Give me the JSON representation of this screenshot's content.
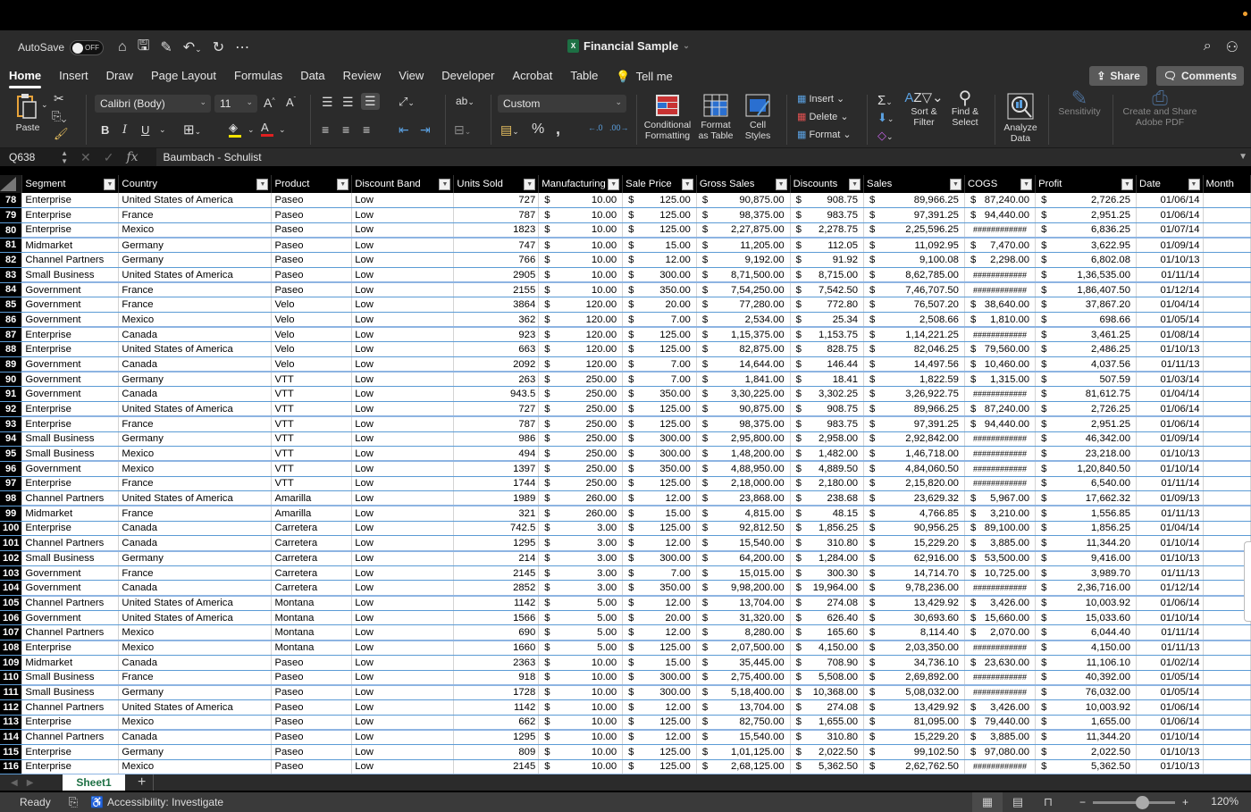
{
  "titlebar": {
    "autosave_label": "AutoSave",
    "autosave_state": "OFF",
    "doc_title": "Financial Sample",
    "app_badge": "X"
  },
  "tabs": [
    "Home",
    "Insert",
    "Draw",
    "Page Layout",
    "Formulas",
    "Data",
    "Review",
    "View",
    "Developer",
    "Acrobat",
    "Table"
  ],
  "active_tab": "Home",
  "tell_me": "Tell me",
  "share_label": "Share",
  "comments_label": "Comments",
  "ribbon": {
    "paste": "Paste",
    "font_name": "Calibri (Body)",
    "font_size": "11",
    "number_format": "Custom",
    "conditional_formatting": [
      "Conditional",
      "Formatting"
    ],
    "format_as_table": [
      "Format",
      "as Table"
    ],
    "cell_styles": [
      "Cell",
      "Styles"
    ],
    "insert": "Insert",
    "delete": "Delete",
    "format": "Format",
    "sort_filter": [
      "Sort &",
      "Filter"
    ],
    "find_select": [
      "Find &",
      "Select"
    ],
    "analyze_data": [
      "Analyze",
      "Data"
    ],
    "sensitivity": "Sensitivity",
    "adobe_pdf": [
      "Create and Share",
      "Adobe PDF"
    ],
    "colors": {
      "highlight": "#f5e400",
      "font_color": "#e02020"
    }
  },
  "formula_bar": {
    "name_box": "Q638",
    "formula": "Baumbach - Schulist"
  },
  "columns": [
    "Segment",
    "Country",
    "Product",
    "Discount Band",
    "Units Sold",
    "Manufacturing",
    "Sale Price",
    "Gross Sales",
    "Discounts",
    "Sales",
    "COGS",
    "Profit",
    "Date",
    "Month"
  ],
  "rows": [
    {
      "n": "78",
      "seg": "Enterprise",
      "country": "United States of America",
      "product": "Paseo",
      "band": "Low",
      "units": "727",
      "mfg": "10.00",
      "price": "125.00",
      "gross": "90,875.00",
      "disc": "908.75",
      "sales": "89,966.25",
      "cogs": "87,240.00",
      "profit": "2,726.25",
      "date": "01/06/14"
    },
    {
      "n": "79",
      "seg": "Enterprise",
      "country": "France",
      "product": "Paseo",
      "band": "Low",
      "units": "787",
      "mfg": "10.00",
      "price": "125.00",
      "gross": "98,375.00",
      "disc": "983.75",
      "sales": "97,391.25",
      "cogs": "94,440.00",
      "profit": "2,951.25",
      "date": "01/06/14"
    },
    {
      "n": "80",
      "seg": "Enterprise",
      "country": "Mexico",
      "product": "Paseo",
      "band": "Low",
      "units": "1823",
      "mfg": "10.00",
      "price": "125.00",
      "gross": "2,27,875.00",
      "disc": "2,278.75",
      "sales": "2,25,596.25",
      "cogs": "############",
      "profit": "6,836.25",
      "date": "01/07/14"
    },
    {
      "n": "81",
      "seg": "Midmarket",
      "country": "Germany",
      "product": "Paseo",
      "band": "Low",
      "units": "747",
      "mfg": "10.00",
      "price": "15.00",
      "gross": "11,205.00",
      "disc": "112.05",
      "sales": "11,092.95",
      "cogs": "7,470.00",
      "profit": "3,622.95",
      "date": "01/09/14"
    },
    {
      "n": "82",
      "seg": "Channel Partners",
      "country": "Germany",
      "product": "Paseo",
      "band": "Low",
      "units": "766",
      "mfg": "10.00",
      "price": "12.00",
      "gross": "9,192.00",
      "disc": "91.92",
      "sales": "9,100.08",
      "cogs": "2,298.00",
      "profit": "6,802.08",
      "date": "01/10/13"
    },
    {
      "n": "83",
      "seg": "Small Business",
      "country": "United States of America",
      "product": "Paseo",
      "band": "Low",
      "units": "2905",
      "mfg": "10.00",
      "price": "300.00",
      "gross": "8,71,500.00",
      "disc": "8,715.00",
      "sales": "8,62,785.00",
      "cogs": "############",
      "profit": "1,36,535.00",
      "date": "01/11/14"
    },
    {
      "n": "84",
      "seg": "Government",
      "country": "France",
      "product": "Paseo",
      "band": "Low",
      "units": "2155",
      "mfg": "10.00",
      "price": "350.00",
      "gross": "7,54,250.00",
      "disc": "7,542.50",
      "sales": "7,46,707.50",
      "cogs": "############",
      "profit": "1,86,407.50",
      "date": "01/12/14"
    },
    {
      "n": "85",
      "seg": "Government",
      "country": "France",
      "product": "Velo",
      "band": "Low",
      "units": "3864",
      "mfg": "120.00",
      "price": "20.00",
      "gross": "77,280.00",
      "disc": "772.80",
      "sales": "76,507.20",
      "cogs": "38,640.00",
      "profit": "37,867.20",
      "date": "01/04/14"
    },
    {
      "n": "86",
      "seg": "Government",
      "country": "Mexico",
      "product": "Velo",
      "band": "Low",
      "units": "362",
      "mfg": "120.00",
      "price": "7.00",
      "gross": "2,534.00",
      "disc": "25.34",
      "sales": "2,508.66",
      "cogs": "1,810.00",
      "profit": "698.66",
      "date": "01/05/14"
    },
    {
      "n": "87",
      "seg": "Enterprise",
      "country": "Canada",
      "product": "Velo",
      "band": "Low",
      "units": "923",
      "mfg": "120.00",
      "price": "125.00",
      "gross": "1,15,375.00",
      "disc": "1,153.75",
      "sales": "1,14,221.25",
      "cogs": "############",
      "profit": "3,461.25",
      "date": "01/08/14"
    },
    {
      "n": "88",
      "seg": "Enterprise",
      "country": "United States of America",
      "product": "Velo",
      "band": "Low",
      "units": "663",
      "mfg": "120.00",
      "price": "125.00",
      "gross": "82,875.00",
      "disc": "828.75",
      "sales": "82,046.25",
      "cogs": "79,560.00",
      "profit": "2,486.25",
      "date": "01/10/13"
    },
    {
      "n": "89",
      "seg": "Government",
      "country": "Canada",
      "product": "Velo",
      "band": "Low",
      "units": "2092",
      "mfg": "120.00",
      "price": "7.00",
      "gross": "14,644.00",
      "disc": "146.44",
      "sales": "14,497.56",
      "cogs": "10,460.00",
      "profit": "4,037.56",
      "date": "01/11/13"
    },
    {
      "n": "90",
      "seg": "Government",
      "country": "Germany",
      "product": "VTT",
      "band": "Low",
      "units": "263",
      "mfg": "250.00",
      "price": "7.00",
      "gross": "1,841.00",
      "disc": "18.41",
      "sales": "1,822.59",
      "cogs": "1,315.00",
      "profit": "507.59",
      "date": "01/03/14"
    },
    {
      "n": "91",
      "seg": "Government",
      "country": "Canada",
      "product": "VTT",
      "band": "Low",
      "units": "943.5",
      "mfg": "250.00",
      "price": "350.00",
      "gross": "3,30,225.00",
      "disc": "3,302.25",
      "sales": "3,26,922.75",
      "cogs": "############",
      "profit": "81,612.75",
      "date": "01/04/14"
    },
    {
      "n": "92",
      "seg": "Enterprise",
      "country": "United States of America",
      "product": "VTT",
      "band": "Low",
      "units": "727",
      "mfg": "250.00",
      "price": "125.00",
      "gross": "90,875.00",
      "disc": "908.75",
      "sales": "89,966.25",
      "cogs": "87,240.00",
      "profit": "2,726.25",
      "date": "01/06/14"
    },
    {
      "n": "93",
      "seg": "Enterprise",
      "country": "France",
      "product": "VTT",
      "band": "Low",
      "units": "787",
      "mfg": "250.00",
      "price": "125.00",
      "gross": "98,375.00",
      "disc": "983.75",
      "sales": "97,391.25",
      "cogs": "94,440.00",
      "profit": "2,951.25",
      "date": "01/06/14"
    },
    {
      "n": "94",
      "seg": "Small Business",
      "country": "Germany",
      "product": "VTT",
      "band": "Low",
      "units": "986",
      "mfg": "250.00",
      "price": "300.00",
      "gross": "2,95,800.00",
      "disc": "2,958.00",
      "sales": "2,92,842.00",
      "cogs": "############",
      "profit": "46,342.00",
      "date": "01/09/14"
    },
    {
      "n": "95",
      "seg": "Small Business",
      "country": "Mexico",
      "product": "VTT",
      "band": "Low",
      "units": "494",
      "mfg": "250.00",
      "price": "300.00",
      "gross": "1,48,200.00",
      "disc": "1,482.00",
      "sales": "1,46,718.00",
      "cogs": "############",
      "profit": "23,218.00",
      "date": "01/10/13"
    },
    {
      "n": "96",
      "seg": "Government",
      "country": "Mexico",
      "product": "VTT",
      "band": "Low",
      "units": "1397",
      "mfg": "250.00",
      "price": "350.00",
      "gross": "4,88,950.00",
      "disc": "4,889.50",
      "sales": "4,84,060.50",
      "cogs": "############",
      "profit": "1,20,840.50",
      "date": "01/10/14"
    },
    {
      "n": "97",
      "seg": "Enterprise",
      "country": "France",
      "product": "VTT",
      "band": "Low",
      "units": "1744",
      "mfg": "250.00",
      "price": "125.00",
      "gross": "2,18,000.00",
      "disc": "2,180.00",
      "sales": "2,15,820.00",
      "cogs": "############",
      "profit": "6,540.00",
      "date": "01/11/14"
    },
    {
      "n": "98",
      "seg": "Channel Partners",
      "country": "United States of America",
      "product": "Amarilla",
      "band": "Low",
      "units": "1989",
      "mfg": "260.00",
      "price": "12.00",
      "gross": "23,868.00",
      "disc": "238.68",
      "sales": "23,629.32",
      "cogs": "5,967.00",
      "profit": "17,662.32",
      "date": "01/09/13"
    },
    {
      "n": "99",
      "seg": "Midmarket",
      "country": "France",
      "product": "Amarilla",
      "band": "Low",
      "units": "321",
      "mfg": "260.00",
      "price": "15.00",
      "gross": "4,815.00",
      "disc": "48.15",
      "sales": "4,766.85",
      "cogs": "3,210.00",
      "profit": "1,556.85",
      "date": "01/11/13"
    },
    {
      "n": "100",
      "seg": "Enterprise",
      "country": "Canada",
      "product": "Carretera",
      "band": "Low",
      "units": "742.5",
      "mfg": "3.00",
      "price": "125.00",
      "gross": "92,812.50",
      "disc": "1,856.25",
      "sales": "90,956.25",
      "cogs": "89,100.00",
      "profit": "1,856.25",
      "date": "01/04/14"
    },
    {
      "n": "101",
      "seg": "Channel Partners",
      "country": "Canada",
      "product": "Carretera",
      "band": "Low",
      "units": "1295",
      "mfg": "3.00",
      "price": "12.00",
      "gross": "15,540.00",
      "disc": "310.80",
      "sales": "15,229.20",
      "cogs": "3,885.00",
      "profit": "11,344.20",
      "date": "01/10/14"
    },
    {
      "n": "102",
      "seg": "Small Business",
      "country": "Germany",
      "product": "Carretera",
      "band": "Low",
      "units": "214",
      "mfg": "3.00",
      "price": "300.00",
      "gross": "64,200.00",
      "disc": "1,284.00",
      "sales": "62,916.00",
      "cogs": "53,500.00",
      "profit": "9,416.00",
      "date": "01/10/13"
    },
    {
      "n": "103",
      "seg": "Government",
      "country": "France",
      "product": "Carretera",
      "band": "Low",
      "units": "2145",
      "mfg": "3.00",
      "price": "7.00",
      "gross": "15,015.00",
      "disc": "300.30",
      "sales": "14,714.70",
      "cogs": "10,725.00",
      "profit": "3,989.70",
      "date": "01/11/13"
    },
    {
      "n": "104",
      "seg": "Government",
      "country": "Canada",
      "product": "Carretera",
      "band": "Low",
      "units": "2852",
      "mfg": "3.00",
      "price": "350.00",
      "gross": "9,98,200.00",
      "disc": "19,964.00",
      "sales": "9,78,236.00",
      "cogs": "############",
      "profit": "2,36,716.00",
      "date": "01/12/14"
    },
    {
      "n": "105",
      "seg": "Channel Partners",
      "country": "United States of America",
      "product": "Montana",
      "band": "Low",
      "units": "1142",
      "mfg": "5.00",
      "price": "12.00",
      "gross": "13,704.00",
      "disc": "274.08",
      "sales": "13,429.92",
      "cogs": "3,426.00",
      "profit": "10,003.92",
      "date": "01/06/14"
    },
    {
      "n": "106",
      "seg": "Government",
      "country": "United States of America",
      "product": "Montana",
      "band": "Low",
      "units": "1566",
      "mfg": "5.00",
      "price": "20.00",
      "gross": "31,320.00",
      "disc": "626.40",
      "sales": "30,693.60",
      "cogs": "15,660.00",
      "profit": "15,033.60",
      "date": "01/10/14"
    },
    {
      "n": "107",
      "seg": "Channel Partners",
      "country": "Mexico",
      "product": "Montana",
      "band": "Low",
      "units": "690",
      "mfg": "5.00",
      "price": "12.00",
      "gross": "8,280.00",
      "disc": "165.60",
      "sales": "8,114.40",
      "cogs": "2,070.00",
      "profit": "6,044.40",
      "date": "01/11/14"
    },
    {
      "n": "108",
      "seg": "Enterprise",
      "country": "Mexico",
      "product": "Montana",
      "band": "Low",
      "units": "1660",
      "mfg": "5.00",
      "price": "125.00",
      "gross": "2,07,500.00",
      "disc": "4,150.00",
      "sales": "2,03,350.00",
      "cogs": "############",
      "profit": "4,150.00",
      "date": "01/11/13"
    },
    {
      "n": "109",
      "seg": "Midmarket",
      "country": "Canada",
      "product": "Paseo",
      "band": "Low",
      "units": "2363",
      "mfg": "10.00",
      "price": "15.00",
      "gross": "35,445.00",
      "disc": "708.90",
      "sales": "34,736.10",
      "cogs": "23,630.00",
      "profit": "11,106.10",
      "date": "01/02/14"
    },
    {
      "n": "110",
      "seg": "Small Business",
      "country": "France",
      "product": "Paseo",
      "band": "Low",
      "units": "918",
      "mfg": "10.00",
      "price": "300.00",
      "gross": "2,75,400.00",
      "disc": "5,508.00",
      "sales": "2,69,892.00",
      "cogs": "############",
      "profit": "40,392.00",
      "date": "01/05/14"
    },
    {
      "n": "111",
      "seg": "Small Business",
      "country": "Germany",
      "product": "Paseo",
      "band": "Low",
      "units": "1728",
      "mfg": "10.00",
      "price": "300.00",
      "gross": "5,18,400.00",
      "disc": "10,368.00",
      "sales": "5,08,032.00",
      "cogs": "############",
      "profit": "76,032.00",
      "date": "01/05/14"
    },
    {
      "n": "112",
      "seg": "Channel Partners",
      "country": "United States of America",
      "product": "Paseo",
      "band": "Low",
      "units": "1142",
      "mfg": "10.00",
      "price": "12.00",
      "gross": "13,704.00",
      "disc": "274.08",
      "sales": "13,429.92",
      "cogs": "3,426.00",
      "profit": "10,003.92",
      "date": "01/06/14"
    },
    {
      "n": "113",
      "seg": "Enterprise",
      "country": "Mexico",
      "product": "Paseo",
      "band": "Low",
      "units": "662",
      "mfg": "10.00",
      "price": "125.00",
      "gross": "82,750.00",
      "disc": "1,655.00",
      "sales": "81,095.00",
      "cogs": "79,440.00",
      "profit": "1,655.00",
      "date": "01/06/14"
    },
    {
      "n": "114",
      "seg": "Channel Partners",
      "country": "Canada",
      "product": "Paseo",
      "band": "Low",
      "units": "1295",
      "mfg": "10.00",
      "price": "12.00",
      "gross": "15,540.00",
      "disc": "310.80",
      "sales": "15,229.20",
      "cogs": "3,885.00",
      "profit": "11,344.20",
      "date": "01/10/14"
    },
    {
      "n": "115",
      "seg": "Enterprise",
      "country": "Germany",
      "product": "Paseo",
      "band": "Low",
      "units": "809",
      "mfg": "10.00",
      "price": "125.00",
      "gross": "1,01,125.00",
      "disc": "2,022.50",
      "sales": "99,102.50",
      "cogs": "97,080.00",
      "profit": "2,022.50",
      "date": "01/10/13"
    },
    {
      "n": "116",
      "seg": "Enterprise",
      "country": "Mexico",
      "product": "Paseo",
      "band": "Low",
      "units": "2145",
      "mfg": "10.00",
      "price": "125.00",
      "gross": "2,68,125.00",
      "disc": "5,362.50",
      "sales": "2,62,762.50",
      "cogs": "############",
      "profit": "5,362.50",
      "date": "01/10/13"
    }
  ],
  "currency_symbol": "$",
  "sheet_tabs": [
    "Sheet1"
  ],
  "status": {
    "ready": "Ready",
    "accessibility": "Accessibility: Investigate",
    "zoom_level": "120%",
    "zoom_fraction": 0.6
  }
}
